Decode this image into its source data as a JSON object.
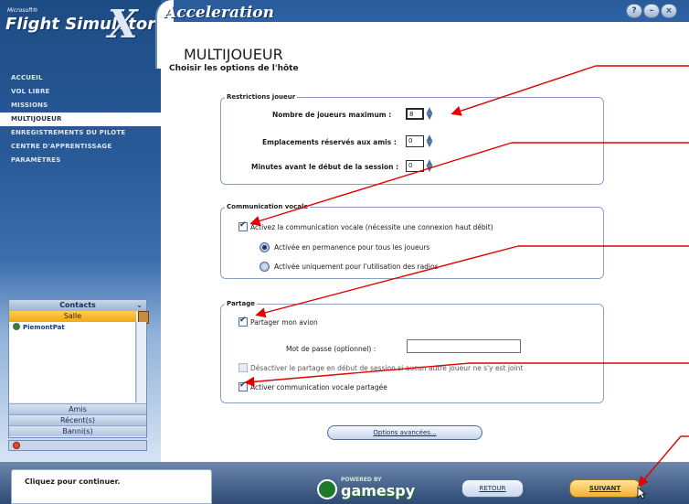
{
  "app": {
    "brand_small": "Microsoft®",
    "brand": "Flight Simulator",
    "brand_x": "X",
    "edition": "Acceleration"
  },
  "window_controls": [
    "help-icon",
    "minimize-icon",
    "close-icon"
  ],
  "nav": {
    "items": [
      {
        "label": "ACCUEIL",
        "active": false
      },
      {
        "label": "VOL LIBRE",
        "active": false
      },
      {
        "label": "MISSIONS",
        "active": false
      },
      {
        "label": "MULTIJOUEUR",
        "active": true
      },
      {
        "label": "ENREGISTREMENTS DU PILOTE",
        "active": false
      },
      {
        "label": "CENTRE D'APPRENTISSAGE",
        "active": false
      },
      {
        "label": "PARAMÈTRES",
        "active": false
      }
    ]
  },
  "contacts": {
    "title": "Contacts",
    "room_tab": "Salle",
    "list": [
      "PiemontPat"
    ],
    "tabs": [
      "Amis",
      "Récent(s)",
      "Banni(s)"
    ]
  },
  "page": {
    "title": "MULTIJOUEUR",
    "subtitle": "Choisir les options de l'hôte"
  },
  "restrictions": {
    "legend": "Restrictions joueur",
    "max_players_label": "Nombre de joueurs maximum :",
    "max_players_value": "8",
    "reserved_slots_label": "Emplacements réservés aux amis :",
    "reserved_slots_value": "0",
    "minutes_label": "Minutes avant le début de la session :",
    "minutes_value": "0"
  },
  "voice": {
    "legend": "Communication vocale",
    "enable_label": "Activez la communication vocale (nécessite une connexion haut débit)",
    "enable_checked": true,
    "option_always": "Activée en permanence pour tous les joueurs",
    "option_radio_only": "Activée uniquement pour l'utilisation des radios",
    "selected_option": "option_always"
  },
  "sharing": {
    "legend": "Partage",
    "share_plane_label": "Partager mon avion",
    "share_plane_checked": true,
    "password_label": "Mot de passe (optionnel) :",
    "password_value": "",
    "disable_share_label": "Désactiver le partage en début de session si aucun autre joueur ne s'y est joint",
    "disable_share_checked": false,
    "shared_voice_label": "Activer communication vocale partagée",
    "shared_voice_checked": true
  },
  "advanced_button": "Options avancées...",
  "footer": {
    "status": "Cliquez pour continuer.",
    "gamespy_top": "POWERED BY",
    "gamespy_main": "gamespy",
    "back": "RETOUR",
    "next": "SUIVANT"
  },
  "annotation_color": "#e00000"
}
